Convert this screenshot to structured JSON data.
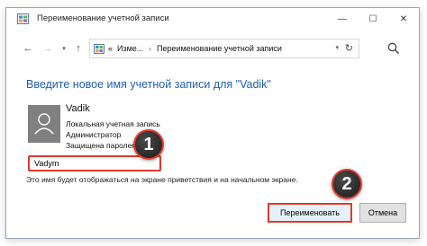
{
  "window": {
    "title": "Переименование учетной записи",
    "controls": {
      "minimize": "—",
      "maximize": "☐",
      "close": "✕"
    }
  },
  "address_bar": {
    "overflow": "«",
    "segment1": "Изме...",
    "separator": "›",
    "segment2": "Переименование учетной записи"
  },
  "content": {
    "heading": "Введите новое имя учетной записи для \"Vadik\"",
    "account": {
      "name": "Vadik",
      "type": "Локальная учетная запись",
      "role": "Администратор",
      "protection": "Защищена паролем"
    },
    "new_name_value": "Vadym",
    "hint": "Это имя будет отображаться на экране приветствия и на начальном экране."
  },
  "buttons": {
    "rename": "Переименовать",
    "cancel": "Отмена"
  },
  "annotations": {
    "step1": "1",
    "step2": "2"
  },
  "colors": {
    "heading": "#1e5fb0",
    "highlight": "#e03a2e",
    "avatar": "#808080"
  }
}
